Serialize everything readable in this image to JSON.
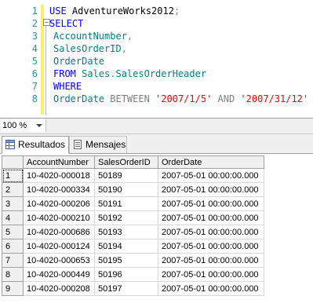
{
  "editor": {
    "lines": [
      {
        "n": "1",
        "segments": [
          {
            "t": "USE ",
            "c": "kw"
          },
          {
            "t": "AdventureWorks2012",
            "c": "plain"
          },
          {
            "t": ";",
            "c": "gray"
          }
        ]
      },
      {
        "n": "2",
        "segments": [
          {
            "t": "SELECT",
            "c": "kw"
          }
        ]
      },
      {
        "n": "3",
        "segments": [
          {
            "t": "AccountNumber",
            "c": "sc"
          },
          {
            "t": ",",
            "c": "gray"
          }
        ]
      },
      {
        "n": "4",
        "segments": [
          {
            "t": "SalesOrderID",
            "c": "sc"
          },
          {
            "t": ",",
            "c": "gray"
          }
        ]
      },
      {
        "n": "5",
        "segments": [
          {
            "t": "OrderDate",
            "c": "sc"
          }
        ]
      },
      {
        "n": "6",
        "segments": [
          {
            "t": "FROM ",
            "c": "kw"
          },
          {
            "t": "Sales",
            "c": "sc"
          },
          {
            "t": ".",
            "c": "gray"
          },
          {
            "t": "SalesOrderHeader",
            "c": "sc"
          }
        ]
      },
      {
        "n": "7",
        "segments": [
          {
            "t": "WHERE",
            "c": "kw"
          }
        ]
      },
      {
        "n": "8",
        "segments": [
          {
            "t": "OrderDate ",
            "c": "sc"
          },
          {
            "t": "BETWEEN ",
            "c": "gray"
          },
          {
            "t": "'2007/1/5'",
            "c": "str"
          },
          {
            "t": " AND ",
            "c": "gray"
          },
          {
            "t": "'2007/31/12'",
            "c": "str"
          }
        ]
      }
    ]
  },
  "zoom": {
    "value": "100 %"
  },
  "tabs": {
    "results": "Resultados",
    "messages": "Mensajes"
  },
  "grid": {
    "headers": [
      "AccountNumber",
      "SalesOrderID",
      "OrderDate"
    ],
    "rows": [
      {
        "n": "1",
        "cells": [
          "10-4020-000018",
          "50189",
          "2007-05-01 00:00:00.000"
        ]
      },
      {
        "n": "2",
        "cells": [
          "10-4020-000334",
          "50190",
          "2007-05-01 00:00:00.000"
        ]
      },
      {
        "n": "3",
        "cells": [
          "10-4020-000206",
          "50191",
          "2007-05-01 00:00:00.000"
        ]
      },
      {
        "n": "4",
        "cells": [
          "10-4020-000210",
          "50192",
          "2007-05-01 00:00:00.000"
        ]
      },
      {
        "n": "5",
        "cells": [
          "10-4020-000686",
          "50193",
          "2007-05-01 00:00:00.000"
        ]
      },
      {
        "n": "6",
        "cells": [
          "10-4020-000124",
          "50194",
          "2007-05-01 00:00:00.000"
        ]
      },
      {
        "n": "7",
        "cells": [
          "10-4020-000653",
          "50195",
          "2007-05-01 00:00:00.000"
        ]
      },
      {
        "n": "8",
        "cells": [
          "10-4020-000449",
          "50196",
          "2007-05-01 00:00:00.000"
        ]
      },
      {
        "n": "9",
        "cells": [
          "10-4020-000208",
          "50197",
          "2007-05-01 00:00:00.000"
        ]
      }
    ]
  },
  "colors": {
    "keyword": "#0000ff",
    "identifier": "#008080",
    "string": "#ff0000",
    "operator": "#808080",
    "line_number": "#2b91af",
    "change_marker": "#ffee62"
  },
  "icons": {
    "results_tab": "grid-icon",
    "messages_tab": "messages-icon",
    "zoom_dropdown": "chevron-down-icon"
  }
}
